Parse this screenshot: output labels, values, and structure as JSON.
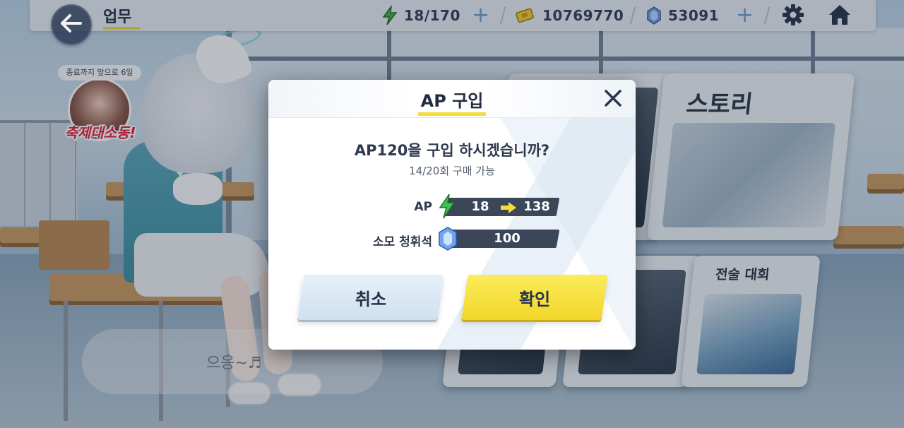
{
  "topbar": {
    "title": "업무",
    "ap_value": "18/170",
    "credits_value": "10769770",
    "gems_value": "53091"
  },
  "event": {
    "timer_text": "종료까지 앞으로 6일",
    "title": "축제대소동!"
  },
  "menu_cards": {
    "story_label": "스토리",
    "tournament_label": "전술 대회"
  },
  "speech": {
    "text": "으응~♬"
  },
  "dialog": {
    "title": "AP 구입",
    "question": "AP120을 구입 하시겠습니까?",
    "limit": "14/20회 구매 가능",
    "ap_label": "AP",
    "ap_from": "18",
    "ap_to": "138",
    "cost_label": "소모 청휘석",
    "cost_value": "100",
    "cancel_label": "취소",
    "confirm_label": "확인"
  },
  "colors": {
    "accent_yellow": "#f3dd3c",
    "dark_navy": "#26324a",
    "bar_dark": "#3b4659",
    "ap_green": "#3fb24a",
    "gem_blue": "#5a8fe0"
  },
  "icons": [
    "back-arrow-icon",
    "lightning-icon",
    "plus-icon",
    "credit-ticket-icon",
    "gem-icon",
    "gear-icon",
    "home-icon",
    "close-icon",
    "right-arrow-icon"
  ]
}
